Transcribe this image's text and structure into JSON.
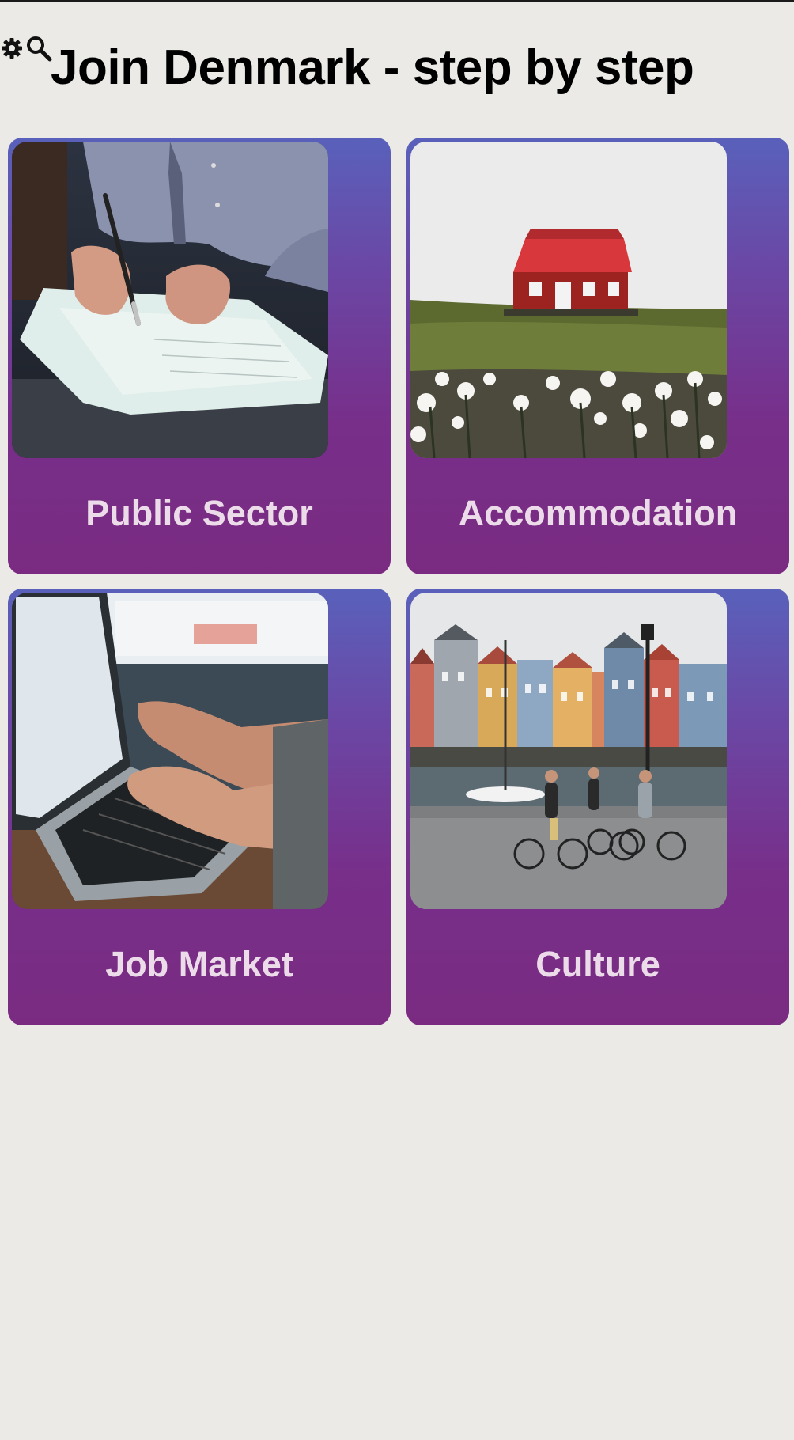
{
  "header": {
    "title": "Join Denmark - step by step",
    "icons": [
      "gear-icon",
      "search-icon"
    ]
  },
  "cards": [
    {
      "label": "Public Sector",
      "image": "person-signing-document-photo"
    },
    {
      "label": "Accommodation",
      "image": "red-house-on-hill-photo"
    },
    {
      "label": "Job Market",
      "image": "hands-typing-laptop-photo"
    },
    {
      "label": "Culture",
      "image": "nyhavn-cyclists-photo"
    }
  ],
  "colors": {
    "background": "#ebeae6",
    "card_gradient_top": "#5961bb",
    "card_gradient_bottom": "#7a2b81",
    "card_label": "#ecdbe9",
    "title": "#000000"
  }
}
